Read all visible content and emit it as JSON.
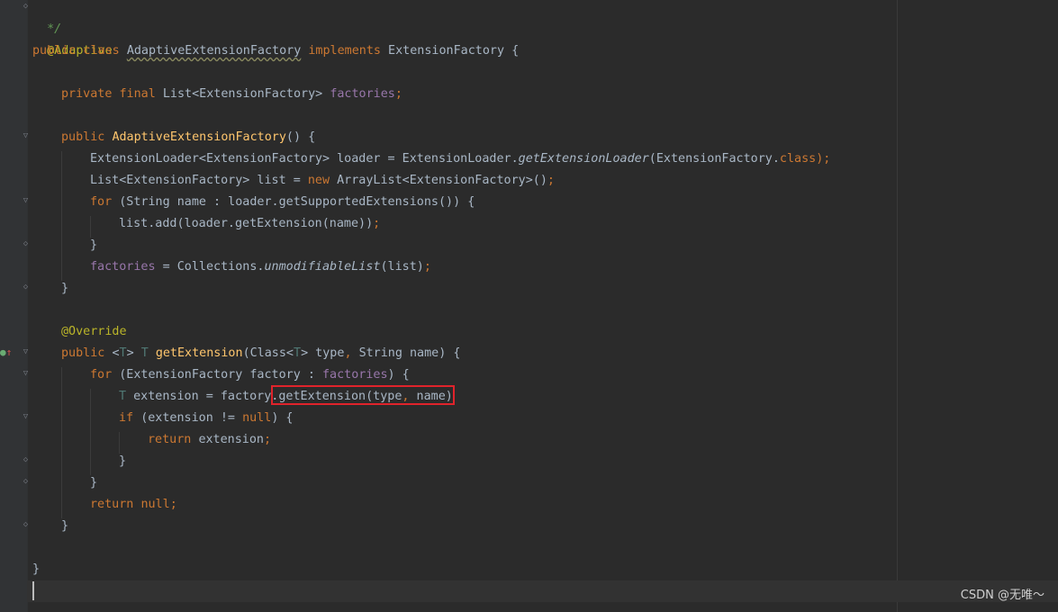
{
  "editor": {
    "lines": {
      "l1": [
        "*/"
      ],
      "l2": [
        "@Adaptive"
      ],
      "l3": [
        "public class ",
        "AdaptiveExtensionFactory",
        " implements ",
        "ExtensionFactory {"
      ],
      "l5": [
        "private final ",
        "List<ExtensionFactory> ",
        "factories",
        ";"
      ],
      "l7": [
        "public ",
        "AdaptiveExtensionFactory",
        "() {"
      ],
      "l8": [
        "ExtensionLoader<ExtensionFactory> loader = ExtensionLoader.",
        "getExtensionLoader",
        "(ExtensionFactory.",
        "class",
        ");"
      ],
      "l9": [
        "List<ExtensionFactory> list = ",
        "new ",
        "ArrayList<ExtensionFactory>()",
        ";"
      ],
      "l10": [
        "for ",
        "(String name : loader.getSupportedExtensions()) {"
      ],
      "l11": [
        "list.add(loader.getExtension(name))",
        ";"
      ],
      "l12": [
        "}"
      ],
      "l13": [
        "factories",
        " = Collections.",
        "unmodifiableList",
        "(list)",
        ";"
      ],
      "l14": [
        "}"
      ],
      "l16": [
        "@Override"
      ],
      "l17": [
        "public ",
        "<",
        "T",
        "> ",
        "T ",
        "getExtension",
        "(Class<",
        "T",
        "> type",
        ", ",
        "String name) {"
      ],
      "l18": [
        "for ",
        "(ExtensionFactory factory : ",
        "factories",
        ") {"
      ],
      "l19": [
        "T ",
        "extension = factory.getExtension(type",
        ", ",
        "name)"
      ],
      "l20": [
        "if ",
        "(extension != ",
        "null",
        ") {"
      ],
      "l21": [
        "return ",
        "extension",
        ";"
      ],
      "l22": [
        "}"
      ],
      "l23": [
        "}"
      ],
      "l24": [
        "return ",
        "null",
        ";"
      ],
      "l25": [
        "}"
      ],
      "l27": [
        "}"
      ]
    }
  },
  "watermark": "CSDN @无唯～",
  "colors": {
    "background": "#2b2b2b",
    "keyword": "#cc7832",
    "annotation": "#bbb529",
    "field": "#9876aa",
    "method_declaration": "#ffc66d",
    "type_parameter": "#507874",
    "default_text": "#a9b7c6",
    "highlight_box": "#e0232b"
  },
  "icons": {
    "fold_marker": "fold-marker-icon",
    "implementation_marker": "override-implementation-icon"
  }
}
